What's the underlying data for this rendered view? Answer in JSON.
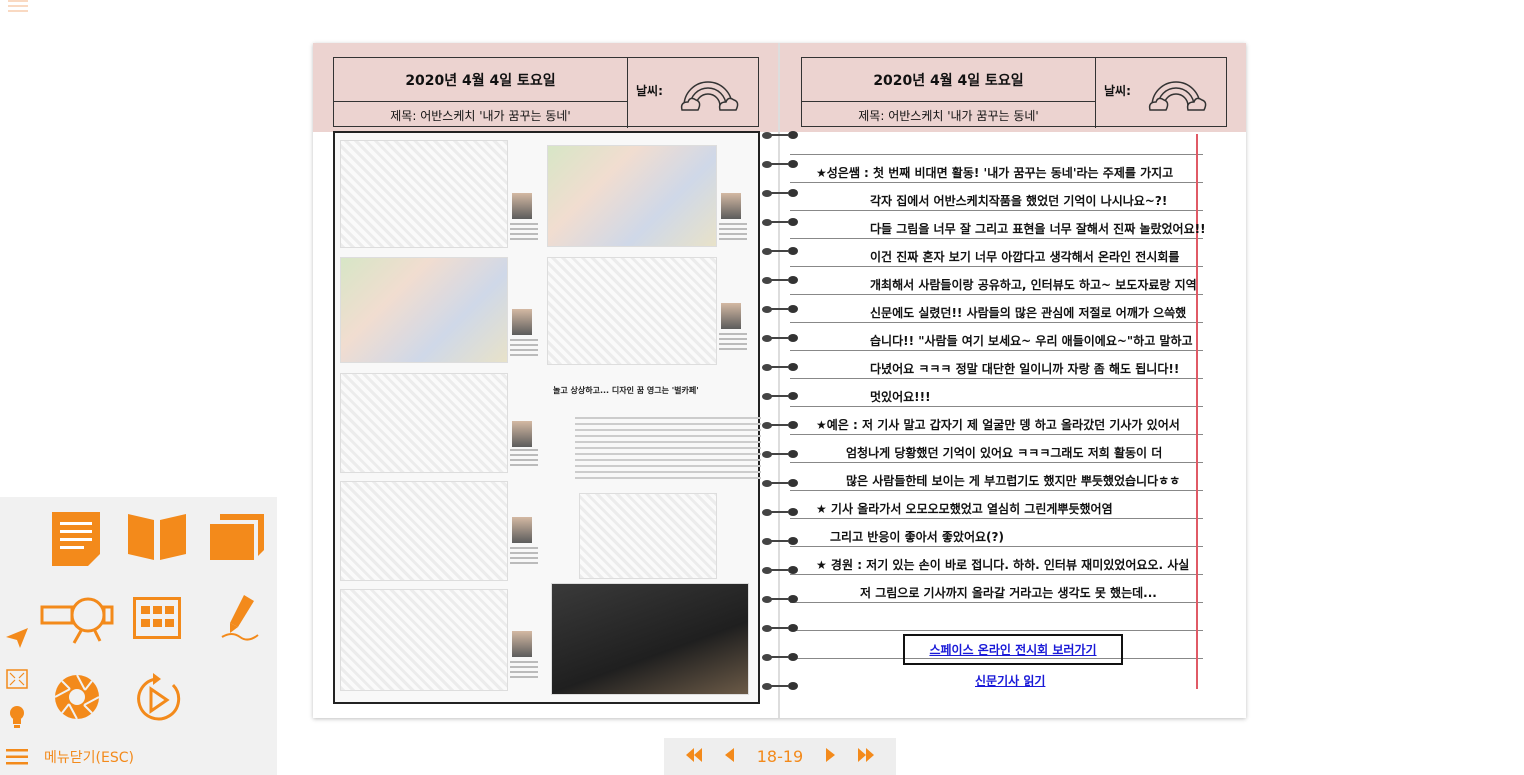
{
  "left_page": {
    "date": "2020년 4월 4일 토요일",
    "title": "제목: 어반스케치 '내가 꿈꾸는 동네'",
    "weather_label": "날씨:",
    "weather_icon": "rainbow-cloud-icon",
    "news_headline": "놀고 상상하고... 디자인 꿈 영그는 '벌카페'"
  },
  "right_page": {
    "date": "2020년 4월 4일 토요일",
    "title": "제목: 어반스케치 '내가 꿈꾸는 동네'",
    "weather_label": "날씨:",
    "weather_icon": "rainbow-cloud-icon",
    "lines": [
      "★성은쌤 : 첫 번째 비대면 활동! '내가 꿈꾸는 동네'라는 주제를 가지고",
      "각자 집에서 어반스케치작품을 했었던 기억이 나시나요~?!",
      "다들 그림을 너무 잘 그리고 표현을 너무 잘해서 진짜 놀랐었어요!!",
      "이건 진짜 혼자 보기 너무 아깝다고 생각해서 온라인 전시회를",
      "개최해서 사람들이랑 공유하고, 인터뷰도 하고~ 보도자료랑 지역",
      "신문에도 실렸던!! 사람들의 많은 관심에 저절로 어깨가 으쓱했",
      "습니다!! \"사람들 여기 보세요~ 우리 애들이에요~\"하고 말하고",
      "다녔어요 ㅋㅋㅋ 정말 대단한 일이니까 자랑 좀 해도 됩니다!!",
      "멋있어요!!!",
      "★예은 : 저 기사 말고 갑자기 제 얼굴만 뎅 하고 올라갔던 기사가 있어서",
      "엄청나게 당황했던 기억이 있어요 ㅋㅋㅋ그래도 저희 활동이 더",
      "많은 사람들한테 보이는 게 부끄럽기도 했지만 뿌듯했었습니다ㅎㅎ",
      "★ 기사 올라가서 오모오모했었고 열심히 그린게뿌듯했어염",
      "그리고 반응이 좋아서 좋았어요(?)",
      "★ 경원 : 저기 있는 손이 바로 접니다. 하하. 인터뷰 재미있었어요오. 사실",
      "저 그림으로 기사까지 올라갈 거라고는 생각도 못 했는데..."
    ],
    "link_exhibition": "스페이스 온라인 전시회 보러가기",
    "link_article": "신문기사 읽기"
  },
  "side_menu": {
    "icons": [
      "document-icon",
      "book-open-icon",
      "pages-icon",
      "send-icon",
      "magnifier-icon",
      "grid-icon",
      "pen-icon",
      "fullscreen-icon",
      "lightbulb-icon",
      "camera-shutter-icon",
      "autoplay-icon",
      "menu-icon"
    ],
    "close_label": "메뉴닫기(ESC)"
  },
  "pager": {
    "page_label": "18-19",
    "first_icon": "double-chevron-left-icon",
    "prev_icon": "caret-left-icon",
    "next_icon": "caret-right-icon",
    "last_icon": "double-chevron-right-icon"
  },
  "colors": {
    "accent": "#f38a1b",
    "header_pink": "#ecd3d0",
    "margin_red": "#e05a66",
    "link_blue": "#1a1ad8"
  }
}
